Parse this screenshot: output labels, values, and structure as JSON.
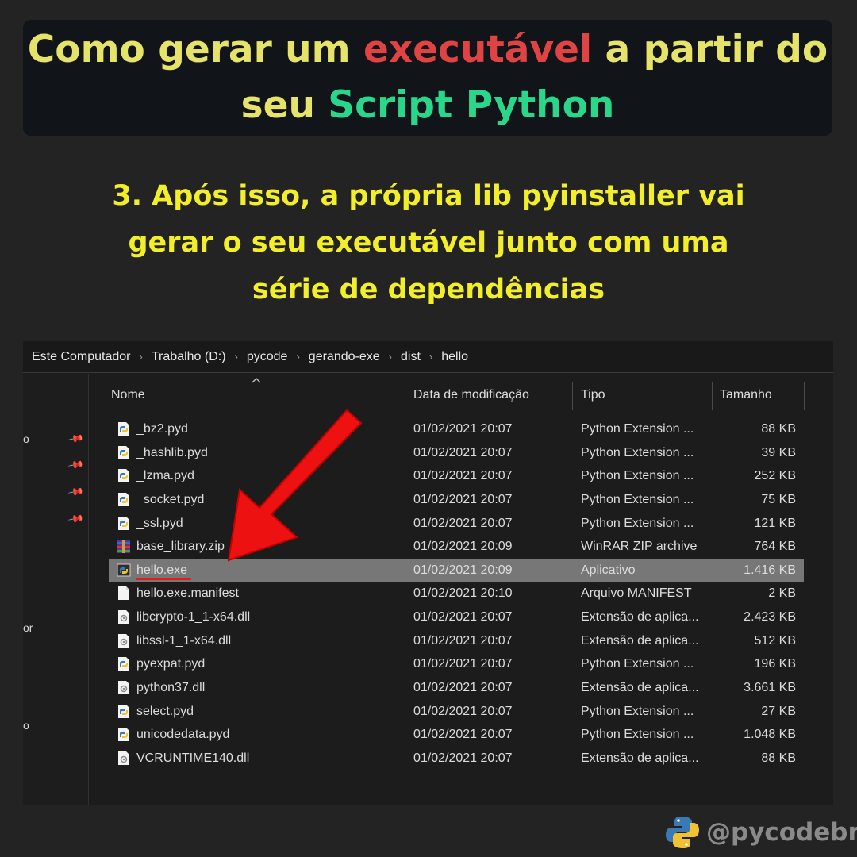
{
  "title": {
    "part1": "Como gerar um ",
    "highlight_red": "executável",
    "part2": " a partir do",
    "part3": "seu ",
    "highlight_green": "Script Python"
  },
  "subtitle": {
    "line1": "3. Após isso, a própria lib pyinstaller vai",
    "line2": "gerar o seu executável junto com uma",
    "line3": "série de dependências"
  },
  "breadcrumb": [
    "Este Computador",
    "Trabalho (D:)",
    "pycode",
    "gerando-exe",
    "dist",
    "hello"
  ],
  "nav_fragments": [
    "o",
    "or",
    "o"
  ],
  "columns": {
    "name": "Nome",
    "date": "Data de modificação",
    "type": "Tipo",
    "size": "Tamanho"
  },
  "files": [
    {
      "name": "_bz2.pyd",
      "date": "01/02/2021 20:07",
      "type": "Python Extension ...",
      "size": "88 KB",
      "icon": "python-file-icon"
    },
    {
      "name": "_hashlib.pyd",
      "date": "01/02/2021 20:07",
      "type": "Python Extension ...",
      "size": "39 KB",
      "icon": "python-file-icon"
    },
    {
      "name": "_lzma.pyd",
      "date": "01/02/2021 20:07",
      "type": "Python Extension ...",
      "size": "252 KB",
      "icon": "python-file-icon"
    },
    {
      "name": "_socket.pyd",
      "date": "01/02/2021 20:07",
      "type": "Python Extension ...",
      "size": "75 KB",
      "icon": "python-file-icon"
    },
    {
      "name": "_ssl.pyd",
      "date": "01/02/2021 20:07",
      "type": "Python Extension ...",
      "size": "121 KB",
      "icon": "python-file-icon"
    },
    {
      "name": "base_library.zip",
      "date": "01/02/2021 20:09",
      "type": "WinRAR ZIP archive",
      "size": "764 KB",
      "icon": "winrar-archive-icon"
    },
    {
      "name": "hello.exe",
      "date": "01/02/2021 20:09",
      "type": "Aplicativo",
      "size": "1.416 KB",
      "icon": "python-exe-icon",
      "selected": true
    },
    {
      "name": "hello.exe.manifest",
      "date": "01/02/2021 20:10",
      "type": "Arquivo MANIFEST",
      "size": "2 KB",
      "icon": "blank-file-icon"
    },
    {
      "name": "libcrypto-1_1-x64.dll",
      "date": "01/02/2021 20:07",
      "type": "Extensão de aplica...",
      "size": "2.423 KB",
      "icon": "dll-file-icon"
    },
    {
      "name": "libssl-1_1-x64.dll",
      "date": "01/02/2021 20:07",
      "type": "Extensão de aplica...",
      "size": "512 KB",
      "icon": "dll-file-icon"
    },
    {
      "name": "pyexpat.pyd",
      "date": "01/02/2021 20:07",
      "type": "Python Extension ...",
      "size": "196 KB",
      "icon": "python-file-icon"
    },
    {
      "name": "python37.dll",
      "date": "01/02/2021 20:07",
      "type": "Extensão de aplica...",
      "size": "3.661 KB",
      "icon": "dll-file-icon"
    },
    {
      "name": "select.pyd",
      "date": "01/02/2021 20:07",
      "type": "Python Extension ...",
      "size": "27 KB",
      "icon": "python-file-icon"
    },
    {
      "name": "unicodedata.pyd",
      "date": "01/02/2021 20:07",
      "type": "Python Extension ...",
      "size": "1.048 KB",
      "icon": "python-file-icon"
    },
    {
      "name": "VCRUNTIME140.dll",
      "date": "01/02/2021 20:07",
      "type": "Extensão de aplica...",
      "size": "88 KB",
      "icon": "dll-file-icon"
    }
  ],
  "brand": {
    "handle": "@pycodebr",
    "logo": "python-logo-icon"
  },
  "colors": {
    "title_yellow": "#e6e36a",
    "title_red": "#e04343",
    "title_green": "#2ad68a",
    "subtitle_yellow": "#f2ef2a",
    "arrow_red": "#ee1111",
    "selection": "#777777"
  }
}
